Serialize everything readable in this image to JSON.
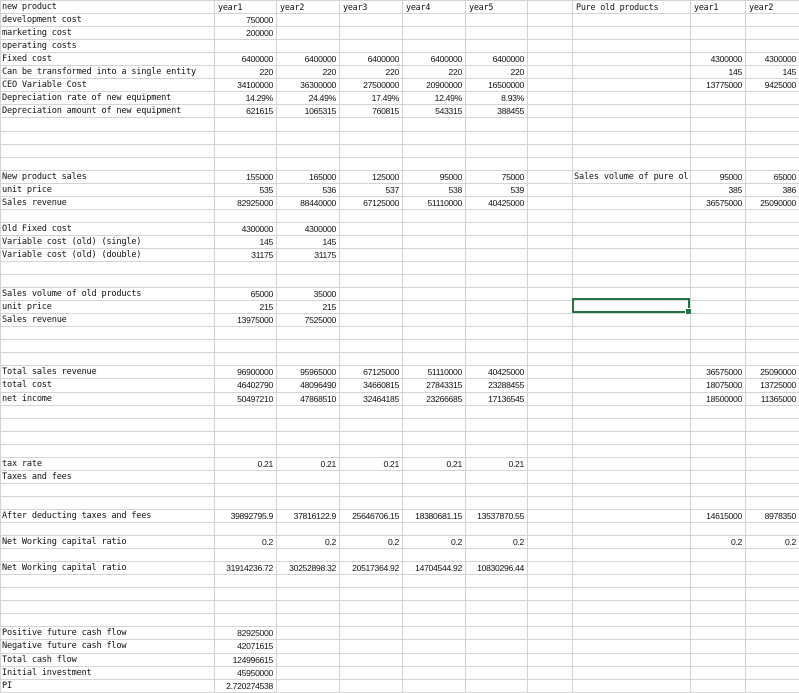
{
  "colors": {
    "grid": "#d4d4d4",
    "selection": "#217346",
    "text": "#111111"
  },
  "headers": {
    "main": [
      "year1",
      "year2",
      "year3",
      "year4",
      "year5"
    ],
    "pure_title": "Pure old products",
    "pure": [
      "year1",
      "year2"
    ]
  },
  "rows": [
    {
      "r": 0,
      "label": "new product",
      "values": [
        "",
        "",
        "",
        "",
        ""
      ],
      "pure_label": "",
      "pure_values": [
        "",
        ""
      ]
    },
    {
      "r": 1,
      "label": "development cost",
      "values": [
        "750000",
        "",
        "",
        "",
        ""
      ],
      "pure_label": "",
      "pure_values": [
        "",
        ""
      ]
    },
    {
      "r": 2,
      "label": "marketing cost",
      "values": [
        "200000",
        "",
        "",
        "",
        ""
      ],
      "pure_label": "",
      "pure_values": [
        "",
        ""
      ]
    },
    {
      "r": 3,
      "label": "operating costs",
      "values": [
        "",
        "",
        "",
        "",
        ""
      ],
      "pure_label": "",
      "pure_values": [
        "",
        ""
      ]
    },
    {
      "r": 4,
      "label": "Fixed cost",
      "values": [
        "6400000",
        "6400000",
        "6400000",
        "6400000",
        "6400000"
      ],
      "pure_label": "",
      "pure_values": [
        "4300000",
        "4300000"
      ]
    },
    {
      "r": 5,
      "label": "Can be transformed into a single entity",
      "values": [
        "220",
        "220",
        "220",
        "220",
        "220"
      ],
      "pure_label": "",
      "pure_values": [
        "145",
        "145"
      ]
    },
    {
      "r": 6,
      "label": "CEO Variable Cost",
      "values": [
        "34100000",
        "36300000",
        "27500000",
        "20900000",
        "16500000"
      ],
      "pure_label": "",
      "pure_values": [
        "13775000",
        "9425000"
      ]
    },
    {
      "r": 7,
      "label": "Depreciation rate of new equipment",
      "values": [
        "14.29%",
        "24.49%",
        "17.49%",
        "12.49%",
        "8.93%"
      ],
      "pure_label": "",
      "pure_values": [
        "",
        ""
      ]
    },
    {
      "r": 8,
      "label": "Depreciation amount of new equipment",
      "values": [
        "621615",
        "1065315",
        "760815",
        "543315",
        "388455"
      ],
      "pure_label": "",
      "pure_values": [
        "",
        ""
      ]
    },
    {
      "r": 13,
      "label": "New product sales",
      "values": [
        "155000",
        "165000",
        "125000",
        "95000",
        "75000"
      ],
      "pure_label": "Sales volume of pure ol",
      "pure_values": [
        "95000",
        "65000"
      ]
    },
    {
      "r": 14,
      "label": "unit price",
      "values": [
        "535",
        "536",
        "537",
        "538",
        "539"
      ],
      "pure_label": "",
      "pure_values": [
        "385",
        "386"
      ]
    },
    {
      "r": 15,
      "label": "Sales revenue",
      "values": [
        "82925000",
        "88440000",
        "67125000",
        "51110000",
        "40425000"
      ],
      "pure_label": "",
      "pure_values": [
        "36575000",
        "25090000"
      ]
    },
    {
      "r": 17,
      "label": "Old Fixed cost",
      "values": [
        "4300000",
        "4300000",
        "",
        "",
        ""
      ],
      "pure_label": "",
      "pure_values": [
        "",
        ""
      ]
    },
    {
      "r": 18,
      "label": "Variable cost (old) (single)",
      "values": [
        "145",
        "145",
        "",
        "",
        ""
      ],
      "pure_label": "",
      "pure_values": [
        "",
        ""
      ]
    },
    {
      "r": 19,
      "label": "Variable cost (old) (double)",
      "values": [
        "31175",
        "31175",
        "",
        "",
        ""
      ],
      "pure_label": "",
      "pure_values": [
        "",
        ""
      ]
    },
    {
      "r": 22,
      "label": "Sales volume of old products",
      "values": [
        "65000",
        "35000",
        "",
        "",
        ""
      ],
      "pure_label": "",
      "pure_values": [
        "",
        ""
      ]
    },
    {
      "r": 23,
      "label": "unit price",
      "values": [
        "215",
        "215",
        "",
        "",
        ""
      ],
      "pure_label": "",
      "pure_values": [
        "",
        ""
      ]
    },
    {
      "r": 24,
      "label": "Sales revenue",
      "values": [
        "13975000",
        "7525000",
        "",
        "",
        ""
      ],
      "pure_label": "",
      "pure_values": [
        "",
        ""
      ]
    },
    {
      "r": 28,
      "label": "Total sales revenue",
      "values": [
        "96900000",
        "95965000",
        "67125000",
        "51110000",
        "40425000"
      ],
      "pure_label": "",
      "pure_values": [
        "36575000",
        "25090000"
      ]
    },
    {
      "r": 29,
      "label": "total cost",
      "values": [
        "46402790",
        "48096490",
        "34660815",
        "27843315",
        "23288455"
      ],
      "pure_label": "",
      "pure_values": [
        "18075000",
        "13725000"
      ]
    },
    {
      "r": 30,
      "label": "net income",
      "values": [
        "50497210",
        "47868510",
        "32464185",
        "23266685",
        "17136545"
      ],
      "pure_label": "",
      "pure_values": [
        "18500000",
        "11365000"
      ]
    },
    {
      "r": 35,
      "label": "tax rate",
      "values": [
        "0.21",
        "0.21",
        "0.21",
        "0.21",
        "0.21"
      ],
      "pure_label": "",
      "pure_values": [
        "",
        ""
      ]
    },
    {
      "r": 36,
      "label": "Taxes and fees",
      "values": [
        "",
        "",
        "",
        "",
        ""
      ],
      "pure_label": "",
      "pure_values": [
        "",
        ""
      ]
    },
    {
      "r": 39,
      "label": "After deducting taxes and fees",
      "values": [
        "39892795.9",
        "37816122.9",
        "25646706.15",
        "18380681.15",
        "13537870.55"
      ],
      "pure_label": "",
      "pure_values": [
        "14615000",
        "8978350"
      ]
    },
    {
      "r": 41,
      "label": "Net Working capital ratio",
      "values": [
        "0.2",
        "0.2",
        "0.2",
        "0.2",
        "0.2"
      ],
      "pure_label": "",
      "pure_values": [
        "0.2",
        "0.2"
      ]
    },
    {
      "r": 43,
      "label": "Net Working capital ratio",
      "values": [
        "31914236.72",
        "30252898.32",
        "20517364.92",
        "14704544.92",
        "10830296.44"
      ],
      "pure_label": "",
      "pure_values": [
        "",
        ""
      ]
    },
    {
      "r": 48,
      "label": "Positive future cash flow",
      "values": [
        "82925000",
        "",
        "",
        "",
        ""
      ],
      "pure_label": "",
      "pure_values": [
        "",
        ""
      ]
    },
    {
      "r": 49,
      "label": "Negative future cash flow",
      "values": [
        "42071615",
        "",
        "",
        "",
        ""
      ],
      "pure_label": "",
      "pure_values": [
        "",
        ""
      ]
    },
    {
      "r": 50,
      "label": "Total cash flow",
      "values": [
        "124996615",
        "",
        "",
        "",
        ""
      ],
      "pure_label": "",
      "pure_values": [
        "",
        ""
      ]
    },
    {
      "r": 51,
      "label": "Initial investment",
      "values": [
        "45950000",
        "",
        "",
        "",
        ""
      ],
      "pure_label": "",
      "pure_values": [
        "",
        ""
      ]
    },
    {
      "r": 52,
      "label": "PI",
      "values": [
        "2.720274538",
        "",
        "",
        "",
        ""
      ],
      "pure_label": "",
      "pure_values": [
        "",
        ""
      ]
    }
  ]
}
